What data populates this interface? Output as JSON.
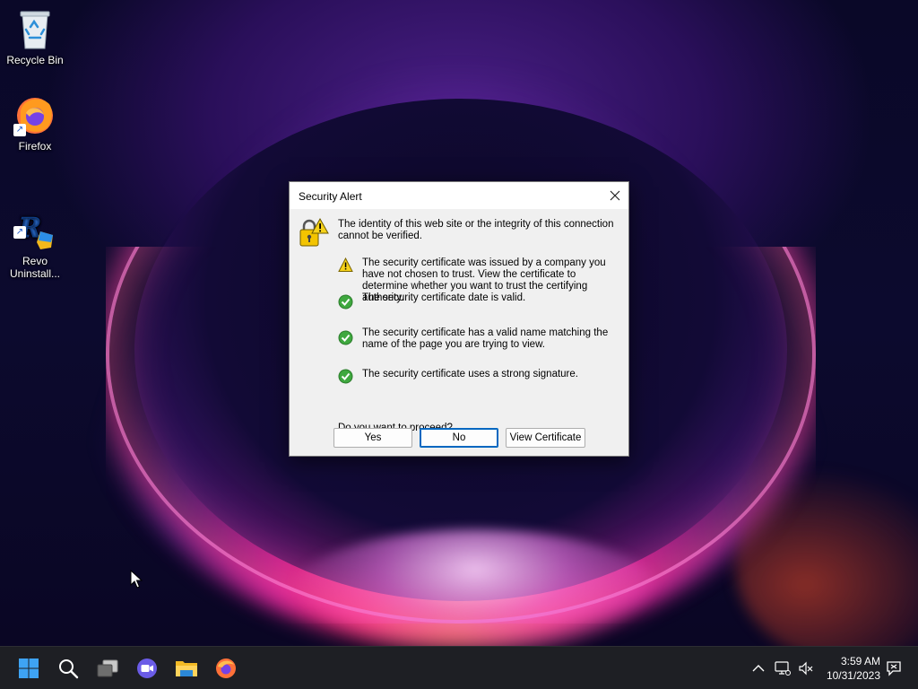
{
  "desktop": {
    "icons": [
      {
        "label": "Recycle Bin"
      },
      {
        "label": "Firefox"
      },
      {
        "label": "Revo\nUninstall..."
      }
    ]
  },
  "dialog": {
    "title": "Security Alert",
    "main_message": "The identity of this web site or the integrity of this connection cannot be verified.",
    "items": [
      {
        "status": "warning",
        "text": "The security certificate was issued by a company you have not chosen to trust. View the certificate to determine whether you want to trust the certifying authority."
      },
      {
        "status": "ok",
        "text": "The security certificate date is valid."
      },
      {
        "status": "ok",
        "text": "The security certificate has a valid name matching the name of the page you are trying to view."
      },
      {
        "status": "ok",
        "text": "The security certificate uses a strong signature."
      }
    ],
    "question": "Do you want to proceed?",
    "buttons": {
      "yes": "Yes",
      "no": "No",
      "view_certificate": "View Certificate"
    }
  },
  "taskbar": {
    "apps": [
      "start-icon",
      "search-icon",
      "task-view-icon",
      "chat-icon",
      "file-explorer-icon",
      "firefox-icon"
    ],
    "tray": [
      "chevron-up-icon",
      "network-icon",
      "volume-muted-icon",
      "notification-icon"
    ],
    "time": "3:59 AM",
    "date": "10/31/2023"
  },
  "colors": {
    "accent": "#0067c0",
    "warning": "#f6d21a",
    "ok": "#3fa83f"
  }
}
